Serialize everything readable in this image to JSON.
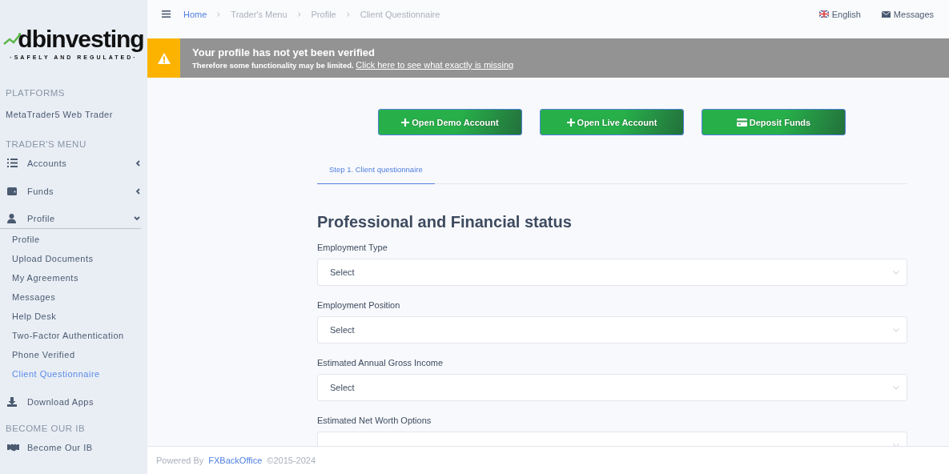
{
  "logo": {
    "name": "dbinvesting",
    "tagline": "·SAFELY AND REGULATED·"
  },
  "sidebar": {
    "sections": [
      {
        "heading": "PLATFORMS",
        "items": [
          {
            "label": "MetaTrader5 Web Trader",
            "kind": "plain",
            "selected": false
          }
        ]
      },
      {
        "heading": "TRADER'S MENU",
        "items": [
          {
            "label": "Accounts",
            "kind": "group",
            "expanded": false,
            "selected": false
          },
          {
            "label": "Funds",
            "kind": "group",
            "expanded": false,
            "selected": false
          },
          {
            "label": "Profile",
            "kind": "group",
            "expanded": true,
            "selected": false,
            "children": [
              {
                "label": "Profile",
                "selected": false
              },
              {
                "label": "Upload Documents",
                "selected": false
              },
              {
                "label": "My Agreements",
                "selected": false
              },
              {
                "label": "Messages",
                "selected": false
              },
              {
                "label": "Help Desk",
                "selected": false
              },
              {
                "label": "Two-Factor Authentication",
                "selected": false
              },
              {
                "label": "Phone Verified",
                "selected": false
              },
              {
                "label": "Client Questionnaire",
                "selected": true
              }
            ]
          },
          {
            "label": "Download Apps",
            "kind": "link",
            "selected": false
          }
        ]
      },
      {
        "heading": "BECOME OUR IB",
        "items": [
          {
            "label": "Become Our IB",
            "kind": "link",
            "selected": false
          }
        ]
      }
    ]
  },
  "topbar": {
    "breadcrumbs": [
      {
        "label": "Home",
        "link": true
      },
      {
        "label": "Trader's Menu",
        "link": false
      },
      {
        "label": "Profile",
        "link": false
      },
      {
        "label": "Client Questionnaire",
        "link": false
      }
    ],
    "language": "English",
    "messages": "Messages"
  },
  "banner": {
    "title": "Your profile has not yet been verified",
    "text": "Therefore some functionality may be limited.",
    "link": "Click here to see what exactly is missing"
  },
  "actions": [
    {
      "label": "Open Demo Account",
      "kind": "create"
    },
    {
      "label": "Open Live Account",
      "kind": "create"
    },
    {
      "label": "Deposit Funds",
      "kind": "deposit"
    }
  ],
  "tabs": [
    {
      "label": "Step 1. Client questionnaire",
      "selected": true
    }
  ],
  "form": {
    "title": "Professional and Financial status",
    "fields": [
      {
        "label": "Employment Type",
        "value": "Select"
      },
      {
        "label": "Employment Position",
        "value": "Select"
      },
      {
        "label": "Estimated Annual Gross Income",
        "value": "Select"
      },
      {
        "label": "Estimated Net Worth Options"
      }
    ]
  },
  "footer": {
    "prefix": "Powered By",
    "link": "FXBackOffice",
    "years": "©2015-2024"
  }
}
